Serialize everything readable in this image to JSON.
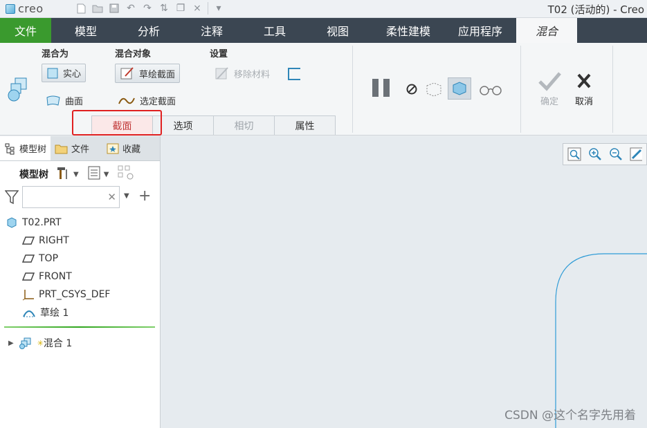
{
  "app": {
    "logo_text": "creo",
    "window_title": "T02 (活动的) - Creo"
  },
  "ribbon_tabs": [
    "文件",
    "模型",
    "分析",
    "注释",
    "工具",
    "视图",
    "柔性建模",
    "应用程序",
    "混合"
  ],
  "ribbon": {
    "blend_as": {
      "label": "混合为",
      "solid": "实心",
      "surface": "曲面"
    },
    "blend_object": {
      "label": "混合对象",
      "sketch_sections": "草绘截面",
      "selected_sections": "选定截面"
    },
    "settings": {
      "label": "设置",
      "remove_material": "移除材料"
    },
    "confirm": "确定",
    "cancel": "取消",
    "subtabs": [
      "截面",
      "选项",
      "相切",
      "属性"
    ]
  },
  "panel": {
    "tabs": [
      "模型树",
      "文件",
      "收藏"
    ],
    "tree_label": "模型树",
    "search_placeholder": "",
    "tree": [
      "T02.PRT",
      "RIGHT",
      "TOP",
      "FRONT",
      "PRT_CSYS_DEF",
      "草绘 1"
    ],
    "feature": "混合 1"
  },
  "watermark": "CSDN @这个名字先用着",
  "colors": {
    "file_tab": "#3a9a2e",
    "tab_bar": "#3b4652",
    "highlight": "#e02020",
    "sketch_curve": "#2e9bd6"
  }
}
